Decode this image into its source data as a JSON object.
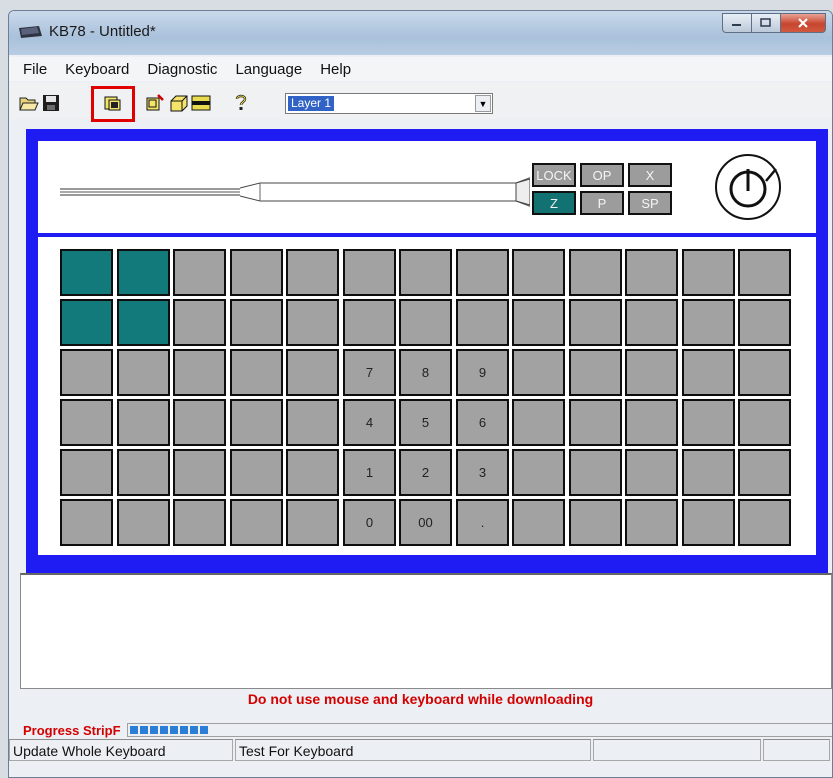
{
  "window": {
    "title": "KB78 - Untitled*"
  },
  "menu": [
    "File",
    "Keyboard",
    "Diagnostic",
    "Language",
    "Help"
  ],
  "toolbar": {
    "icons": [
      "open-folder-icon",
      "save-disk-icon",
      "new-layer-icon",
      "delete-layer-icon",
      "3d-box-icon",
      "strip-icon",
      "help-icon"
    ],
    "layer_select": {
      "value": "Layer 1"
    }
  },
  "device": {
    "mode_buttons": [
      {
        "label": "LOCK",
        "active": false
      },
      {
        "label": "OP",
        "active": false
      },
      {
        "label": "X",
        "active": false
      },
      {
        "label": "Z",
        "active": true
      },
      {
        "label": "P",
        "active": false
      },
      {
        "label": "SP",
        "active": false
      }
    ],
    "key_rows": [
      [
        "",
        "",
        "",
        "",
        "",
        "",
        "",
        "",
        "",
        "",
        "",
        "",
        ""
      ],
      [
        "",
        "",
        "",
        "",
        "",
        "",
        "",
        "",
        "",
        "",
        "",
        "",
        ""
      ],
      [
        "",
        "",
        "",
        "",
        "",
        "7",
        "8",
        "9",
        "",
        "",
        "",
        "",
        ""
      ],
      [
        "",
        "",
        "",
        "",
        "",
        "4",
        "5",
        "6",
        "",
        "",
        "",
        "",
        ""
      ],
      [
        "",
        "",
        "",
        "",
        "",
        "1",
        "2",
        "3",
        "",
        "",
        "",
        "",
        ""
      ],
      [
        "",
        "",
        "",
        "",
        "",
        "0",
        "00",
        ".",
        "",
        "",
        "",
        "",
        ""
      ]
    ],
    "selected_keys": [
      "0-0",
      "0-1",
      "1-0",
      "1-1"
    ]
  },
  "warning": "Do not use mouse and keyboard while downloading",
  "progress": {
    "label": "Progress StripF",
    "value_fraction": 0.11
  },
  "status": [
    "Update Whole Keyboard",
    "Test For Keyboard",
    "",
    ""
  ]
}
